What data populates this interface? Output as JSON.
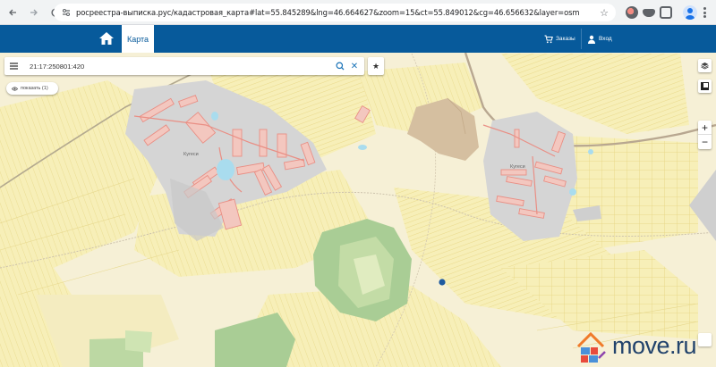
{
  "browser": {
    "url": "росреестра-выписка.рус/кадастровая_карта#lat=55.845289&lng=46.664627&zoom=15&ct=55.849012&cg=46.656632&layer=osm"
  },
  "header": {
    "map_tab": "Карта",
    "orders": "Заказы",
    "login": "Вход"
  },
  "search": {
    "value": "21:17:250801:420"
  },
  "show_button": "показать (1)",
  "map": {
    "label_village_left": "Кугеси",
    "label_village_right": "Кугеси",
    "zoom_in": "+",
    "zoom_out": "−"
  },
  "watermark": {
    "text": "move.ru"
  },
  "colors": {
    "header_blue": "#075a9b",
    "map_land": "#f6eecf",
    "map_yellow_plots": "#f0e69c",
    "parcel_red": "#e98f85",
    "forest_green": "#9bc48f",
    "marker_blue": "#1e5aa0"
  }
}
